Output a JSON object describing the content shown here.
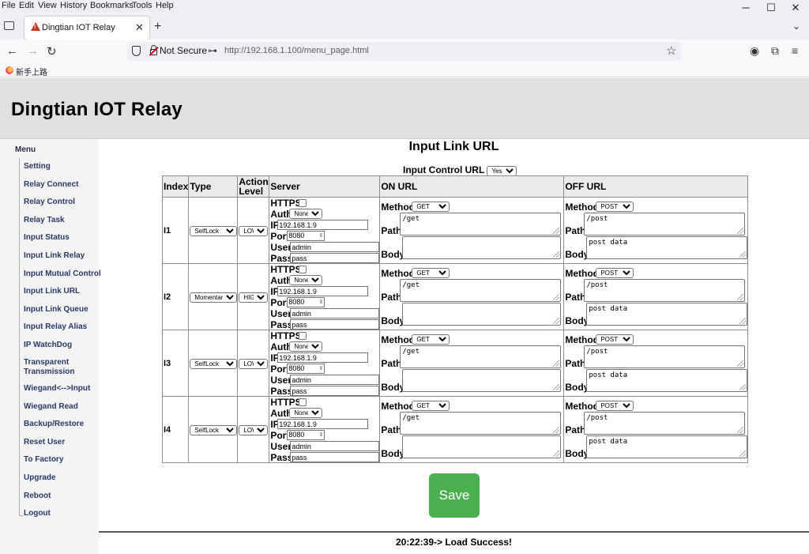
{
  "browser": {
    "menu": [
      "File",
      "Edit",
      "View",
      "History",
      "Bookmarks",
      "Tools",
      "Help"
    ],
    "tab_title": "Dingtian IOT Relay",
    "security_label": "Not Secure",
    "url": "http://192.168.1.100/menu_page.html",
    "bookmark_label": "新手上路"
  },
  "header": {
    "title": "Dingtian IOT Relay"
  },
  "sidebar": {
    "title": "Menu",
    "items": [
      "Setting",
      "Relay Connect",
      "Relay Control",
      "Relay Task",
      "Input Status",
      "Input Link Relay",
      "Input Mutual Control",
      "Input Link URL",
      "Input Link Queue",
      "Input Relay Alias",
      "IP WatchDog",
      "Transparent Transmission",
      "Wiegand<-->Input",
      "Wiegand Read",
      "Backup/Restore",
      "Reset User",
      "To Factory",
      "Upgrade",
      "Reboot",
      "Logout"
    ]
  },
  "main": {
    "title": "Input Link URL",
    "control_label": "Input Control URL",
    "control_value": "Yes",
    "headers": {
      "index": "Index",
      "type": "Type",
      "action": "Action Level",
      "server": "Server",
      "on": "ON URL",
      "off": "OFF URL"
    },
    "labels": {
      "https": "HTTPS",
      "auth": "Auth",
      "ip": "IP",
      "port": "Port",
      "user": "User",
      "pass": "Pass",
      "method": "Method",
      "path": "Path",
      "body": "Body"
    },
    "rows": [
      {
        "index": "I1",
        "type": "SelfLock",
        "level": "LOW",
        "auth": "None",
        "ip": "192.168.1.9",
        "port": "8080",
        "user": "admin",
        "pass": "pass",
        "on_method": "GET",
        "on_path": "/get",
        "on_body": "",
        "off_method": "POST",
        "off_path": "/post",
        "off_body": "post data"
      },
      {
        "index": "I2",
        "type": "Momentary",
        "level": "HIGH",
        "auth": "None",
        "ip": "192.168.1.9",
        "port": "8080",
        "user": "admin",
        "pass": "pass",
        "on_method": "GET",
        "on_path": "/get",
        "on_body": "",
        "off_method": "POST",
        "off_path": "/post",
        "off_body": "post data"
      },
      {
        "index": "I3",
        "type": "SelfLock",
        "level": "LOW",
        "auth": "None",
        "ip": "192.168.1.9",
        "port": "8080",
        "user": "admin",
        "pass": "pass",
        "on_method": "GET",
        "on_path": "/get",
        "on_body": "",
        "off_method": "POST",
        "off_path": "/post",
        "off_body": "post data"
      },
      {
        "index": "I4",
        "type": "SelfLock",
        "level": "LOW",
        "auth": "None",
        "ip": "192.168.1.9",
        "port": "8080",
        "user": "admin",
        "pass": "pass",
        "on_method": "GET",
        "on_path": "/get",
        "on_body": "",
        "off_method": "POST",
        "off_path": "/post",
        "off_body": "post data"
      }
    ],
    "save_label": "Save",
    "status": "20:22:39-> Load Success!"
  }
}
